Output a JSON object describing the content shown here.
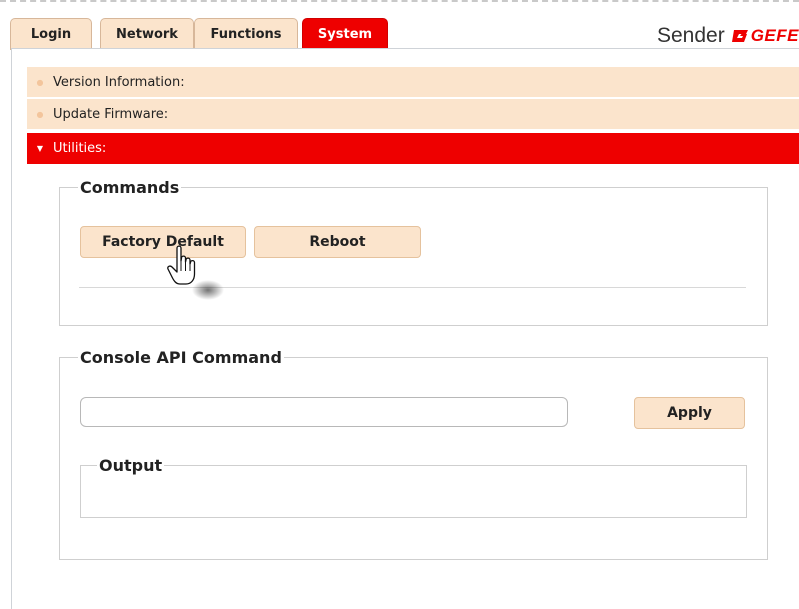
{
  "tabs": [
    {
      "label": "Login",
      "active": false
    },
    {
      "label": "Network",
      "active": false
    },
    {
      "label": "Functions",
      "active": false
    },
    {
      "label": "System",
      "active": true
    }
  ],
  "brand": {
    "title": "Sender",
    "logo_text": "GEFE"
  },
  "accordion": [
    {
      "label": "Version Information:",
      "expanded": false
    },
    {
      "label": "Update Firmware:",
      "expanded": false
    },
    {
      "label": "Utilities:",
      "expanded": true
    }
  ],
  "commands": {
    "legend": "Commands",
    "factory_default_label": "Factory Default",
    "reboot_label": "Reboot"
  },
  "console": {
    "legend": "Console API Command",
    "input_value": "",
    "input_placeholder": "",
    "apply_label": "Apply",
    "output_legend": "Output",
    "output_text": ""
  },
  "colors": {
    "accent": "#ee0000",
    "tab_bg": "#fbe4cc"
  },
  "icons": {
    "collapsed": "bullet-icon",
    "expanded": "triangle-down-icon",
    "pointer": "hand-pointer-icon"
  }
}
